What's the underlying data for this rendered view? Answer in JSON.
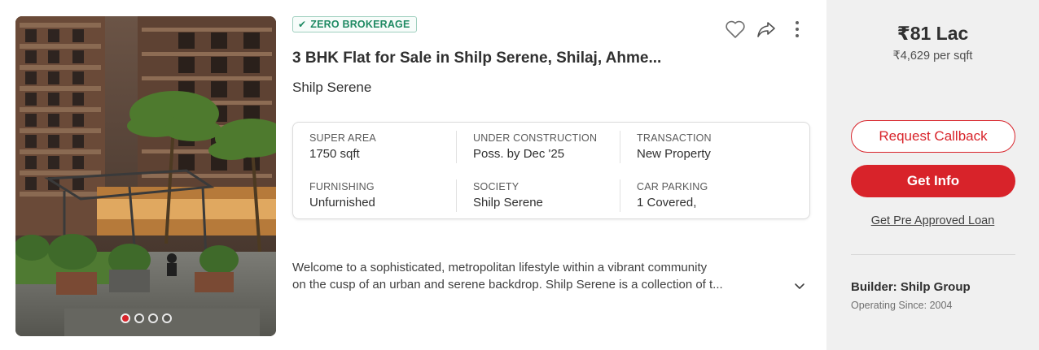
{
  "badge": {
    "label": "ZERO BROKERAGE"
  },
  "listing": {
    "title": "3 BHK Flat for Sale in Shilp Serene, Shilaj, Ahme...",
    "project": "Shilp Serene",
    "summary": [
      {
        "label": "SUPER AREA",
        "value": "1750 sqft"
      },
      {
        "label": "UNDER CONSTRUCTION",
        "value": "Poss. by Dec '25"
      },
      {
        "label": "TRANSACTION",
        "value": "New Property"
      },
      {
        "label": "FURNISHING",
        "value": "Unfurnished"
      },
      {
        "label": "SOCIETY",
        "value": "Shilp Serene"
      },
      {
        "label": "CAR PARKING",
        "value": "1 Covered,"
      }
    ],
    "description": {
      "line1": "Welcome to a sophisticated, metropolitan lifestyle within a vibrant community",
      "line2": "on the cusp of an urban and serene backdrop. Shilp Serene is a collection of t..."
    }
  },
  "gallery": {
    "slide_count": 4,
    "active_slide": 1
  },
  "panel": {
    "price": "₹81 Lac",
    "price_per_sqft": "₹4,629 per sqft",
    "request_callback": "Request Callback",
    "get_info": "Get Info",
    "loan_link": "Get Pre Approved Loan",
    "builder": "Builder: Shilp Group",
    "operating_since": "Operating Since: 2004"
  },
  "icons": {
    "badge": "check-icon",
    "shortlist": "heart-icon",
    "share": "share-icon",
    "more": "more-vertical-icon",
    "expand": "chevron-down-icon"
  },
  "colors": {
    "accent": "#d8232a",
    "badge_green": "#1f8a63",
    "panel_bg": "#f0f0f0"
  }
}
